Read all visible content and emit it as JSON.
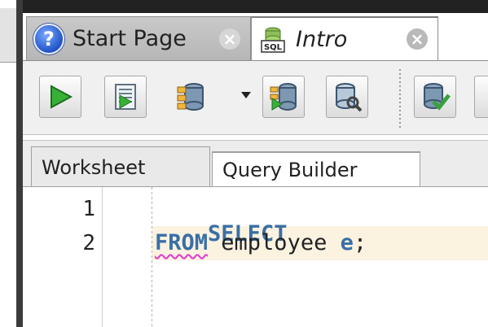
{
  "tabs": [
    {
      "label": "Start Page",
      "icon": "help-icon",
      "active": false
    },
    {
      "label": "Intro",
      "icon": "sql-worksheet-icon",
      "active": true
    }
  ],
  "toolbar": {
    "buttons": [
      {
        "name": "run-statement",
        "icon": "play-icon"
      },
      {
        "name": "run-script",
        "icon": "script-icon"
      },
      {
        "name": "database",
        "icon": "database-icon"
      },
      {
        "name": "explain-plan",
        "icon": "explain-plan-icon"
      },
      {
        "name": "autotrace",
        "icon": "autotrace-icon"
      },
      {
        "name": "commit",
        "icon": "commit-icon"
      }
    ],
    "colors": {
      "play": "#2f9e2f",
      "db": "#5a7a9a",
      "check": "#3aa040"
    }
  },
  "worksheet_tabs": [
    {
      "label": "Worksheet"
    },
    {
      "label": "Query Builder"
    }
  ],
  "editor": {
    "lines": [
      {
        "num": "1",
        "keyword": "SELECT",
        "rest": "",
        "alias": "",
        "end": ""
      },
      {
        "num": "2",
        "keyword": "FROM",
        "rest": " employee ",
        "alias": "e",
        "end": ";"
      }
    ],
    "keyword_color": "#3a6fa6",
    "current_line_color": "#fbf2e0"
  }
}
